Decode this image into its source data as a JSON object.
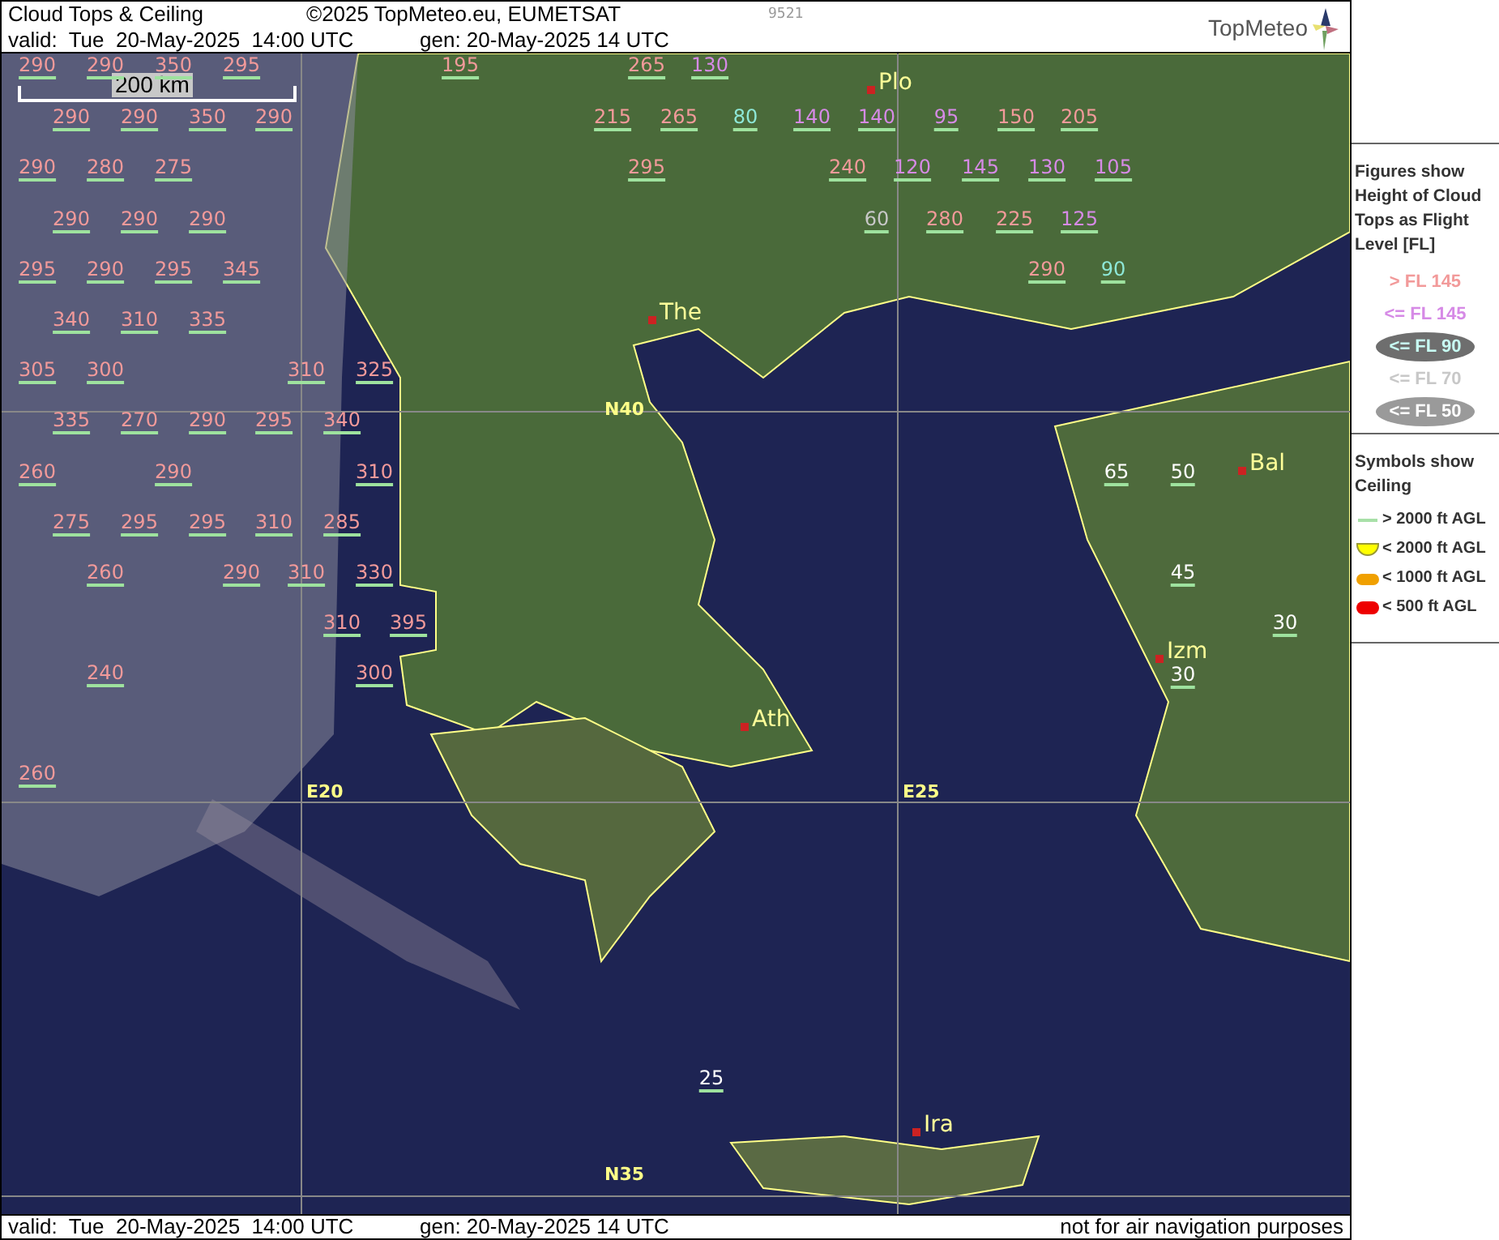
{
  "header": {
    "title": "Cloud Tops & Ceiling",
    "copyright": "©2025 TopMeteo.eu, EUMETSAT",
    "code": "9521",
    "valid": "valid:  Tue  20-May-2025  14:00 UTC",
    "generated": "gen: 20-May-2025 14 UTC",
    "logo": "TopMeteo"
  },
  "map": {
    "scale": "200 km",
    "grid_labels": [
      "N40",
      "E20",
      "E25",
      "N35"
    ],
    "cities": [
      "Plo",
      "The",
      "Ath",
      "Bal",
      "Izm",
      "Ira"
    ],
    "cloud_tops": [
      {
        "value": "290",
        "kind": "above_145"
      },
      {
        "value": "290",
        "kind": "above_145"
      },
      {
        "value": "350",
        "kind": "above_145"
      },
      {
        "value": "295",
        "kind": "above_145"
      },
      {
        "value": "195",
        "kind": "above_145"
      },
      {
        "value": "265",
        "kind": "above_145"
      },
      {
        "value": "130",
        "kind": "below_145"
      },
      {
        "value": "290",
        "kind": "above_145"
      },
      {
        "value": "290",
        "kind": "above_145"
      },
      {
        "value": "350",
        "kind": "above_145"
      },
      {
        "value": "290",
        "kind": "above_145"
      },
      {
        "value": "215",
        "kind": "above_145"
      },
      {
        "value": "265",
        "kind": "above_145"
      },
      {
        "value": "80",
        "kind": "below_90"
      },
      {
        "value": "140",
        "kind": "below_145"
      },
      {
        "value": "140",
        "kind": "below_145"
      },
      {
        "value": "95",
        "kind": "below_145"
      },
      {
        "value": "150",
        "kind": "above_145"
      },
      {
        "value": "205",
        "kind": "above_145"
      },
      {
        "value": "290",
        "kind": "above_145"
      },
      {
        "value": "280",
        "kind": "above_145"
      },
      {
        "value": "275",
        "kind": "above_145"
      },
      {
        "value": "295",
        "kind": "above_145"
      },
      {
        "value": "240",
        "kind": "above_145"
      },
      {
        "value": "120",
        "kind": "below_145"
      },
      {
        "value": "145",
        "kind": "below_145"
      },
      {
        "value": "130",
        "kind": "below_145"
      },
      {
        "value": "105",
        "kind": "below_145"
      },
      {
        "value": "290",
        "kind": "above_145"
      },
      {
        "value": "290",
        "kind": "above_145"
      },
      {
        "value": "290",
        "kind": "above_145"
      },
      {
        "value": "60",
        "kind": "below_70"
      },
      {
        "value": "280",
        "kind": "above_145"
      },
      {
        "value": "225",
        "kind": "above_145"
      },
      {
        "value": "125",
        "kind": "below_145"
      },
      {
        "value": "295",
        "kind": "above_145"
      },
      {
        "value": "290",
        "kind": "above_145"
      },
      {
        "value": "295",
        "kind": "above_145"
      },
      {
        "value": "345",
        "kind": "above_145"
      },
      {
        "value": "290",
        "kind": "above_145"
      },
      {
        "value": "90",
        "kind": "below_90"
      },
      {
        "value": "340",
        "kind": "above_145"
      },
      {
        "value": "310",
        "kind": "above_145"
      },
      {
        "value": "335",
        "kind": "above_145"
      },
      {
        "value": "305",
        "kind": "above_145"
      },
      {
        "value": "300",
        "kind": "above_145"
      },
      {
        "value": "310",
        "kind": "above_145"
      },
      {
        "value": "325",
        "kind": "above_145"
      },
      {
        "value": "335",
        "kind": "above_145"
      },
      {
        "value": "270",
        "kind": "above_145"
      },
      {
        "value": "290",
        "kind": "above_145"
      },
      {
        "value": "295",
        "kind": "above_145"
      },
      {
        "value": "340",
        "kind": "above_145"
      },
      {
        "value": "260",
        "kind": "above_145"
      },
      {
        "value": "290",
        "kind": "above_145"
      },
      {
        "value": "310",
        "kind": "above_145"
      },
      {
        "value": "275",
        "kind": "above_145"
      },
      {
        "value": "295",
        "kind": "above_145"
      },
      {
        "value": "295",
        "kind": "above_145"
      },
      {
        "value": "310",
        "kind": "above_145"
      },
      {
        "value": "285",
        "kind": "above_145"
      },
      {
        "value": "260",
        "kind": "above_145"
      },
      {
        "value": "290",
        "kind": "above_145"
      },
      {
        "value": "310",
        "kind": "above_145"
      },
      {
        "value": "330",
        "kind": "above_145"
      },
      {
        "value": "310",
        "kind": "above_145"
      },
      {
        "value": "395",
        "kind": "above_145"
      },
      {
        "value": "240",
        "kind": "above_145"
      },
      {
        "value": "300",
        "kind": "above_145"
      },
      {
        "value": "260",
        "kind": "above_145"
      }
    ],
    "ceilings": [
      "65",
      "50",
      "45",
      "30",
      "30",
      "25"
    ]
  },
  "footer": {
    "valid": "valid:  Tue  20-May-2025  14:00 UTC",
    "generated": "gen: 20-May-2025 14 UTC",
    "disclaimer": "not for air navigation purposes"
  },
  "legend": {
    "figures_title": "Figures show Height of Cloud Tops as Flight Level  [FL]",
    "levels": [
      {
        "label": "> FL 145",
        "kind": "above_145"
      },
      {
        "label": "<= FL 145",
        "kind": "below_145"
      },
      {
        "label": "<= FL 90",
        "kind": "below_90"
      },
      {
        "label": "<= FL 70",
        "kind": "below_70"
      },
      {
        "label": "<= FL 50",
        "kind": "below_50"
      }
    ],
    "symbols_title": "Symbols show Ceiling",
    "symbols": [
      {
        "label": "> 2000 ft AGL",
        "kind": "above_2000"
      },
      {
        "label": "< 2000 ft AGL",
        "kind": "below_2000"
      },
      {
        "label": "< 1000 ft AGL",
        "kind": "below_1000"
      },
      {
        "label": "< 500 ft AGL",
        "kind": "below_500"
      }
    ]
  }
}
